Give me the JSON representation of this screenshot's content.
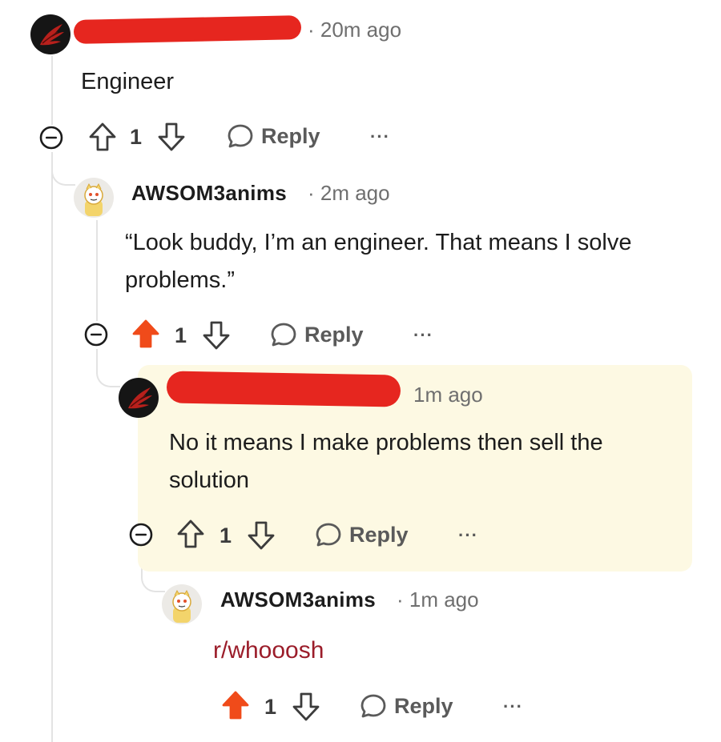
{
  "colors": {
    "upvote_active": "#f04b1a",
    "redaction": "#e6261f",
    "highlight": "#fdf9e3",
    "link": "#9b1d2a"
  },
  "comments": [
    {
      "author_redacted": true,
      "avatar": "dark-phoenix-avatar",
      "meta": "· 20m ago",
      "body": "Engineer",
      "score": "1",
      "upvoted": false,
      "reply_label": "Reply",
      "more_label": "···",
      "collapse_icon": "collapse-minus-icon"
    },
    {
      "author": "AWSOM3anims",
      "avatar": "snoo-mascot-avatar",
      "meta": "· 2m ago",
      "body": "“Look buddy, I’m an engineer. That means I solve problems.”",
      "score": "1",
      "upvoted": true,
      "reply_label": "Reply",
      "more_label": "···",
      "collapse_icon": "collapse-minus-icon"
    },
    {
      "author_redacted": true,
      "avatar": "dark-phoenix-avatar",
      "meta": "1m ago",
      "body": "No it means I make problems then sell the solution",
      "score": "1",
      "upvoted": false,
      "highlighted": true,
      "reply_label": "Reply",
      "more_label": "···",
      "collapse_icon": "collapse-minus-icon"
    },
    {
      "author": "AWSOM3anims",
      "avatar": "snoo-mascot-avatar",
      "meta": "· 1m ago",
      "body": "r/whooosh",
      "score": "1",
      "upvoted": true,
      "reply_label": "Reply",
      "more_label": "···"
    }
  ]
}
